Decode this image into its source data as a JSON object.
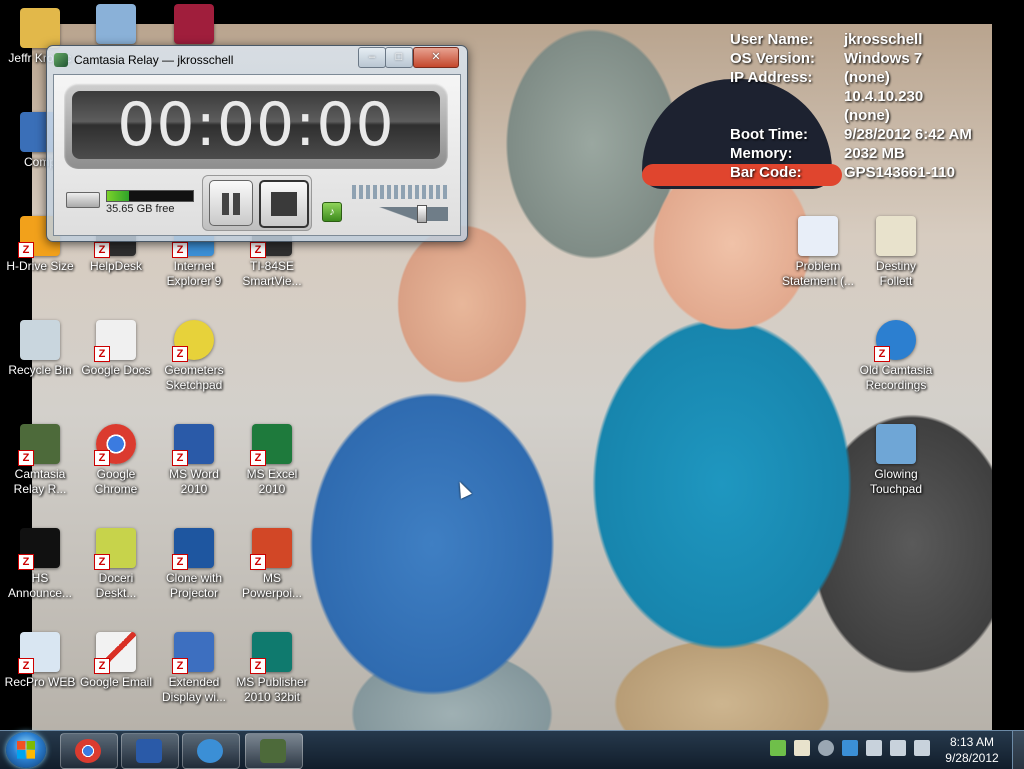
{
  "desktop": {
    "icons": [
      {
        "label": "Jeffr Krossc",
        "color": "#e2b84a"
      },
      {
        "label": "",
        "color": "#8ab1d8"
      },
      {
        "label": "",
        "color": "#a01e3c"
      },
      {
        "label": "Comp",
        "color": "#3a6fb8"
      },
      {
        "label": "H-Drive Size",
        "color": "#f2a11b"
      },
      {
        "label": "HelpDesk",
        "color": "#2e2e2e"
      },
      {
        "label": "Internet Explorer 9",
        "color": "#3b8fd6"
      },
      {
        "label": "TI-84SE SmartVie...",
        "color": "#2f2f2f"
      },
      {
        "label": "Recycle Bin",
        "color": "#c9d6de"
      },
      {
        "label": "Google Docs",
        "color": "#f0f0f0"
      },
      {
        "label": "Geometers Sketchpad",
        "color": "#e7d23a"
      },
      {
        "label": "Camtasia Relay R...",
        "color": "#4d6a3a"
      },
      {
        "label": "Google Chrome",
        "color": "#db3b2f"
      },
      {
        "label": "MS Word 2010",
        "color": "#2a5aa8"
      },
      {
        "label": "MS Excel 2010",
        "color": "#1e7a3c"
      },
      {
        "label": "HS Announce...",
        "color": "#111111"
      },
      {
        "label": "Doceri Deskt...",
        "color": "#c7d34b"
      },
      {
        "label": "Clone with Projector",
        "color": "#1e56a0"
      },
      {
        "label": "MS Powerpoi...",
        "color": "#d24726"
      },
      {
        "label": "RecPro WEB",
        "color": "#d9e6f2"
      },
      {
        "label": "Google Email",
        "color": "#f2f2f2"
      },
      {
        "label": "Extended Display wi...",
        "color": "#3d6fc0"
      },
      {
        "label": "MS Publisher 2010 32bit",
        "color": "#0f7a6e"
      },
      {
        "label": "Problem Statement (...",
        "color": "#e8eef8"
      },
      {
        "label": "Destiny Follett",
        "color": "#e8e2cc"
      },
      {
        "label": "Old Camtasia Recordings",
        "color": "#2c7fd0"
      },
      {
        "label": "Glowing Touchpad",
        "color": "#6fa6d6"
      }
    ]
  },
  "sysinfo": [
    {
      "key": "User Name:",
      "value": "jkrosschell"
    },
    {
      "key": "OS Version:",
      "value": "Windows 7"
    },
    {
      "key": "IP Address:",
      "value": "(none)"
    },
    {
      "key": "",
      "value": "10.4.10.230"
    },
    {
      "key": "",
      "value": "(none)"
    },
    {
      "key": "Boot Time:",
      "value": "9/28/2012 6:42 AM"
    },
    {
      "key": "Memory:",
      "value": "2032 MB"
    },
    {
      "key": "Bar Code:",
      "value": "GPS143661-110"
    }
  ],
  "relay": {
    "title": "Camtasia Relay — jkrosschell",
    "timer": "00:00:00",
    "disk_free": "35.65 GB free",
    "disk_used_fraction": 0.25,
    "minimize": "–",
    "maximize": "□",
    "close": "✕",
    "mic": "♪",
    "volume_level": 0.72
  },
  "taskbar": {
    "apps": [
      {
        "name": "Google Chrome",
        "color": "#db3b2f"
      },
      {
        "name": "Microsoft Word",
        "color": "#2a5aa8"
      },
      {
        "name": "Internet Explorer",
        "color": "#3b8fd6"
      },
      {
        "name": "Camtasia Relay",
        "color": "#4d6a3a"
      }
    ],
    "tray_colors": [
      "#6fbf4a",
      "#e8e2cc",
      "#9aa7b3",
      "#3b8fd6",
      "#c8d2dc",
      "#c8d2dc",
      "#c8d2dc"
    ],
    "time": "8:13 AM",
    "date": "9/28/2012"
  }
}
